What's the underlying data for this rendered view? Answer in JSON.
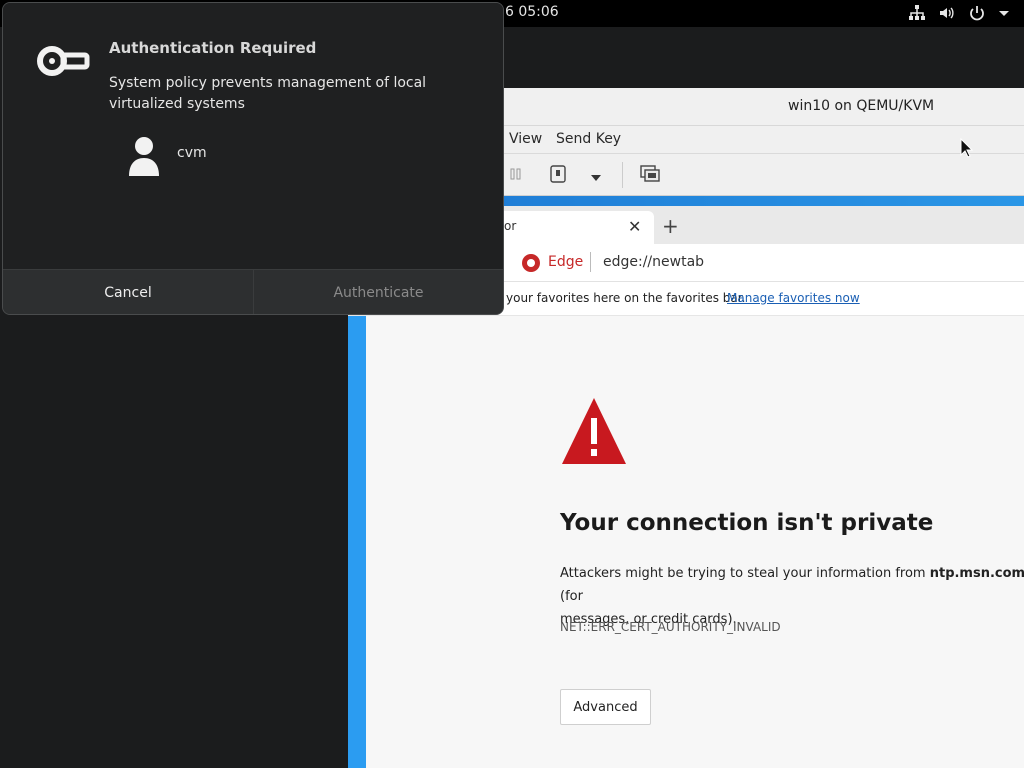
{
  "topbar": {
    "clock": "6  05:06",
    "icons": [
      "network-icon",
      "volume-icon",
      "power-icon",
      "chevron-down-icon"
    ]
  },
  "vm_window": {
    "title": "win10 on QEMU/KVM",
    "menu": {
      "view": "View",
      "send_key": "Send Key"
    }
  },
  "edge": {
    "tab_label": "or",
    "new_tab": "+",
    "site_label": "Edge",
    "url": "edge://newtab",
    "favorites_text": "your favorites here on the favorites bar.",
    "manage_favorites": "Manage favorites now",
    "error_title": "Your connection isn't private",
    "error_desc_pre": "Attackers might be trying to steal your information from ",
    "error_host": "ntp.msn.com",
    "error_desc_post": " (for",
    "error_desc_line2": "messages, or credit cards).",
    "error_code": "NET::ERR_CERT_AUTHORITY_INVALID",
    "advanced_label": "Advanced",
    "colors": {
      "warning": "#c8191f",
      "link": "#1a5fb4"
    }
  },
  "auth_dialog": {
    "title": "Authentication Required",
    "message": "System policy prevents management of local virtualized systems",
    "user": "cvm",
    "cancel_label": "Cancel",
    "authenticate_label": "Authenticate"
  }
}
